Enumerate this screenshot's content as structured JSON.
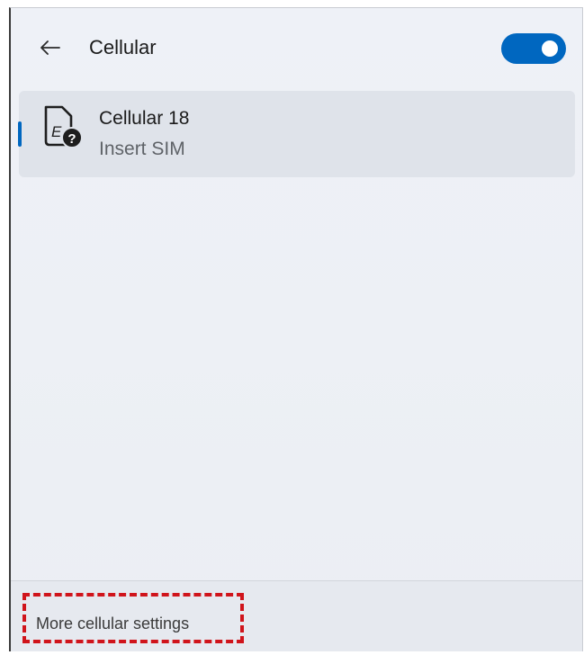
{
  "header": {
    "title": "Cellular",
    "back_icon": "arrow-left-icon",
    "toggle": {
      "state": "on",
      "accent_color": "#0067c0"
    }
  },
  "networks": [
    {
      "name": "Cellular 18",
      "status": "Insert SIM",
      "icon": "sim-unknown-icon",
      "selected": true
    }
  ],
  "footer": {
    "more_settings_label": "More cellular settings",
    "highlight_color": "#d0141b"
  }
}
